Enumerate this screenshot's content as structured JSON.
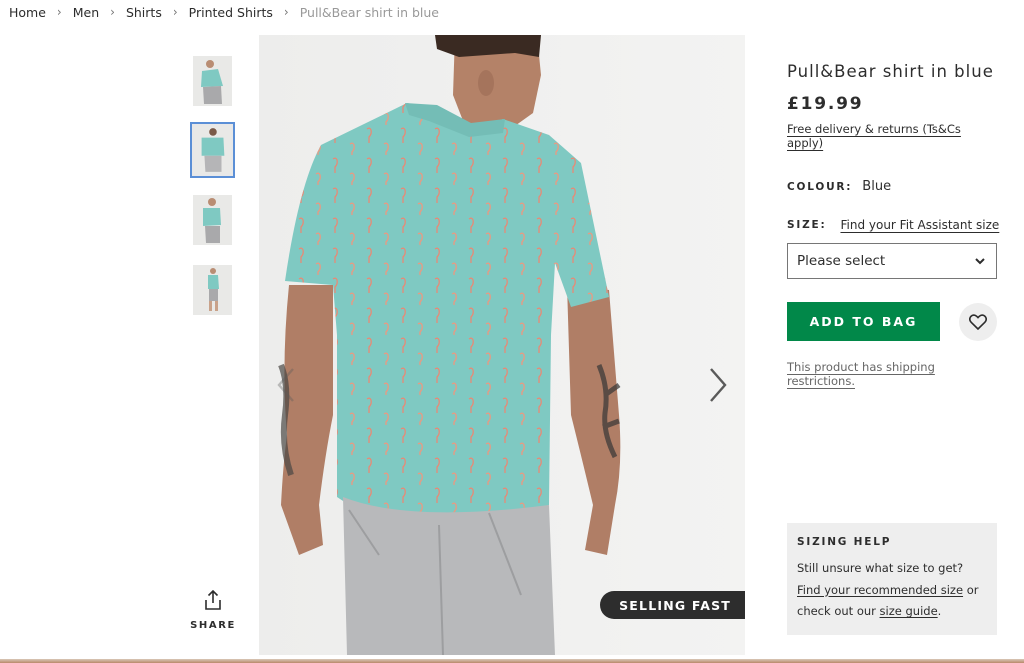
{
  "breadcrumb": {
    "items": [
      "Home",
      "Men",
      "Shirts",
      "Printed Shirts"
    ],
    "current": "Pull&Bear shirt in blue",
    "separator": "›"
  },
  "gallery": {
    "thumbnails": [
      {
        "alt": "front view"
      },
      {
        "alt": "back view",
        "active": true
      },
      {
        "alt": "side view"
      },
      {
        "alt": "full length view"
      }
    ],
    "share_label": "SHARE",
    "badge": "SELLING FAST"
  },
  "product": {
    "title": "Pull&Bear shirt in blue",
    "price": "£19.99",
    "delivery_link": "Free delivery & returns (Ts&Cs apply)",
    "colour_label": "COLOUR:",
    "colour_value": "Blue",
    "size_label": "SIZE:",
    "fit_link": "Find your Fit Assistant size",
    "size_placeholder": "Please select",
    "add_to_bag": "ADD TO BAG",
    "shipping_note": "This product has shipping restrictions."
  },
  "sizing_help": {
    "title": "SIZING HELP",
    "text_1": "Still unsure what size to get?",
    "link_1": "Find your recommended size",
    "text_2": "or check out our",
    "link_2": "size guide",
    "text_3": "."
  },
  "icons": {
    "share": "share-icon",
    "prev": "chevron-left-icon",
    "next": "chevron-right-icon",
    "fit": "fit-assistant-icon",
    "dropdown": "chevron-down-icon",
    "save": "heart-icon"
  },
  "colors": {
    "accent_green": "#018849",
    "text": "#2d2d2d",
    "badge_bg": "#2d2d2d",
    "panel_bg": "#eeeeee",
    "shirt": "#7fc9c2"
  }
}
